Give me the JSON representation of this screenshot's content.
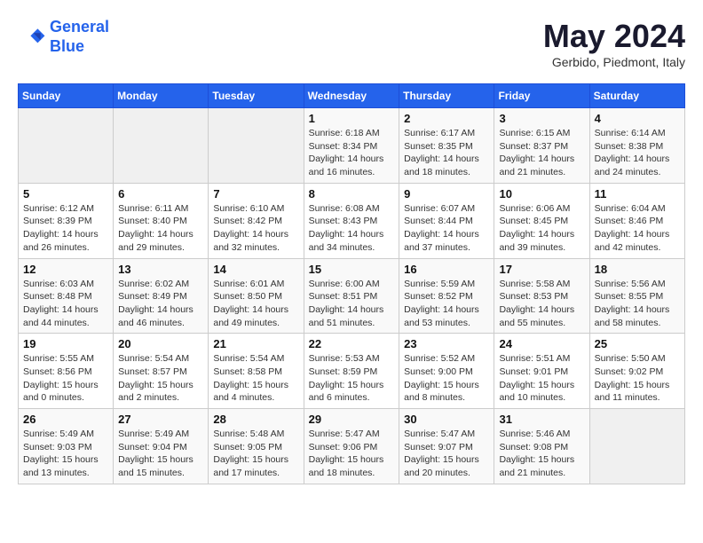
{
  "logo": {
    "line1": "General",
    "line2": "Blue"
  },
  "title": "May 2024",
  "subtitle": "Gerbido, Piedmont, Italy",
  "days_of_week": [
    "Sunday",
    "Monday",
    "Tuesday",
    "Wednesday",
    "Thursday",
    "Friday",
    "Saturday"
  ],
  "weeks": [
    [
      {
        "day": "",
        "info": ""
      },
      {
        "day": "",
        "info": ""
      },
      {
        "day": "",
        "info": ""
      },
      {
        "day": "1",
        "info": "Sunrise: 6:18 AM\nSunset: 8:34 PM\nDaylight: 14 hours and 16 minutes."
      },
      {
        "day": "2",
        "info": "Sunrise: 6:17 AM\nSunset: 8:35 PM\nDaylight: 14 hours and 18 minutes."
      },
      {
        "day": "3",
        "info": "Sunrise: 6:15 AM\nSunset: 8:37 PM\nDaylight: 14 hours and 21 minutes."
      },
      {
        "day": "4",
        "info": "Sunrise: 6:14 AM\nSunset: 8:38 PM\nDaylight: 14 hours and 24 minutes."
      }
    ],
    [
      {
        "day": "5",
        "info": "Sunrise: 6:12 AM\nSunset: 8:39 PM\nDaylight: 14 hours and 26 minutes."
      },
      {
        "day": "6",
        "info": "Sunrise: 6:11 AM\nSunset: 8:40 PM\nDaylight: 14 hours and 29 minutes."
      },
      {
        "day": "7",
        "info": "Sunrise: 6:10 AM\nSunset: 8:42 PM\nDaylight: 14 hours and 32 minutes."
      },
      {
        "day": "8",
        "info": "Sunrise: 6:08 AM\nSunset: 8:43 PM\nDaylight: 14 hours and 34 minutes."
      },
      {
        "day": "9",
        "info": "Sunrise: 6:07 AM\nSunset: 8:44 PM\nDaylight: 14 hours and 37 minutes."
      },
      {
        "day": "10",
        "info": "Sunrise: 6:06 AM\nSunset: 8:45 PM\nDaylight: 14 hours and 39 minutes."
      },
      {
        "day": "11",
        "info": "Sunrise: 6:04 AM\nSunset: 8:46 PM\nDaylight: 14 hours and 42 minutes."
      }
    ],
    [
      {
        "day": "12",
        "info": "Sunrise: 6:03 AM\nSunset: 8:48 PM\nDaylight: 14 hours and 44 minutes."
      },
      {
        "day": "13",
        "info": "Sunrise: 6:02 AM\nSunset: 8:49 PM\nDaylight: 14 hours and 46 minutes."
      },
      {
        "day": "14",
        "info": "Sunrise: 6:01 AM\nSunset: 8:50 PM\nDaylight: 14 hours and 49 minutes."
      },
      {
        "day": "15",
        "info": "Sunrise: 6:00 AM\nSunset: 8:51 PM\nDaylight: 14 hours and 51 minutes."
      },
      {
        "day": "16",
        "info": "Sunrise: 5:59 AM\nSunset: 8:52 PM\nDaylight: 14 hours and 53 minutes."
      },
      {
        "day": "17",
        "info": "Sunrise: 5:58 AM\nSunset: 8:53 PM\nDaylight: 14 hours and 55 minutes."
      },
      {
        "day": "18",
        "info": "Sunrise: 5:56 AM\nSunset: 8:55 PM\nDaylight: 14 hours and 58 minutes."
      }
    ],
    [
      {
        "day": "19",
        "info": "Sunrise: 5:55 AM\nSunset: 8:56 PM\nDaylight: 15 hours and 0 minutes."
      },
      {
        "day": "20",
        "info": "Sunrise: 5:54 AM\nSunset: 8:57 PM\nDaylight: 15 hours and 2 minutes."
      },
      {
        "day": "21",
        "info": "Sunrise: 5:54 AM\nSunset: 8:58 PM\nDaylight: 15 hours and 4 minutes."
      },
      {
        "day": "22",
        "info": "Sunrise: 5:53 AM\nSunset: 8:59 PM\nDaylight: 15 hours and 6 minutes."
      },
      {
        "day": "23",
        "info": "Sunrise: 5:52 AM\nSunset: 9:00 PM\nDaylight: 15 hours and 8 minutes."
      },
      {
        "day": "24",
        "info": "Sunrise: 5:51 AM\nSunset: 9:01 PM\nDaylight: 15 hours and 10 minutes."
      },
      {
        "day": "25",
        "info": "Sunrise: 5:50 AM\nSunset: 9:02 PM\nDaylight: 15 hours and 11 minutes."
      }
    ],
    [
      {
        "day": "26",
        "info": "Sunrise: 5:49 AM\nSunset: 9:03 PM\nDaylight: 15 hours and 13 minutes."
      },
      {
        "day": "27",
        "info": "Sunrise: 5:49 AM\nSunset: 9:04 PM\nDaylight: 15 hours and 15 minutes."
      },
      {
        "day": "28",
        "info": "Sunrise: 5:48 AM\nSunset: 9:05 PM\nDaylight: 15 hours and 17 minutes."
      },
      {
        "day": "29",
        "info": "Sunrise: 5:47 AM\nSunset: 9:06 PM\nDaylight: 15 hours and 18 minutes."
      },
      {
        "day": "30",
        "info": "Sunrise: 5:47 AM\nSunset: 9:07 PM\nDaylight: 15 hours and 20 minutes."
      },
      {
        "day": "31",
        "info": "Sunrise: 5:46 AM\nSunset: 9:08 PM\nDaylight: 15 hours and 21 minutes."
      },
      {
        "day": "",
        "info": ""
      }
    ]
  ]
}
